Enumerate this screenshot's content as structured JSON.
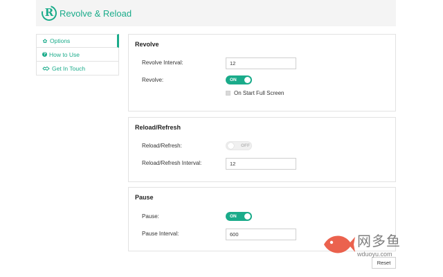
{
  "header": {
    "title": "Revolve & Reload",
    "logo_letter": "R"
  },
  "sidebar": {
    "items": [
      {
        "label": "Options",
        "icon": "gear-icon",
        "active": true
      },
      {
        "label": "How to Use",
        "icon": "question-circle-icon",
        "active": false
      },
      {
        "label": "Get In Touch",
        "icon": "handshake-icon",
        "active": false
      }
    ]
  },
  "revolve": {
    "title": "Revolve",
    "interval_label": "Revolve Interval:",
    "interval_value": "12",
    "toggle_label": "Revolve:",
    "toggle_state": "ON",
    "fullscreen_label": "On Start Full Screen"
  },
  "reload": {
    "title": "Reload/Refresh",
    "toggle_label": "Reload/Refresh:",
    "toggle_state": "OFF",
    "interval_label": "Reload/Refresh Interval:",
    "interval_value": "12"
  },
  "pause": {
    "title": "Pause",
    "toggle_label": "Pause:",
    "toggle_state": "ON",
    "interval_label": "Pause Interval:",
    "interval_value": "600"
  },
  "footer": {
    "reset_label": "Reset"
  },
  "watermark": {
    "name": "网多鱼",
    "url": "wduoyu.com"
  },
  "colors": {
    "accent": "#1aab8a",
    "watermark_red": "#e8462f"
  }
}
